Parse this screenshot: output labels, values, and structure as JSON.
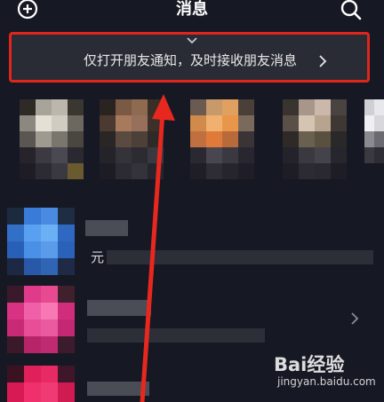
{
  "header": {
    "title": "消息",
    "add_icon": "add-circle-icon",
    "search_icon": "search-icon"
  },
  "banner": {
    "expand_icon": "chevron-down-icon",
    "text": "仅打开朋友通知，及时接收朋友消息",
    "arrow_icon": "chevron-right-icon",
    "highlight_color": "#e0251c"
  },
  "conversations": {
    "snippet_char": "元",
    "row_arrow_icon": "chevron-right-icon"
  },
  "watermark": {
    "brand": "Bai经验",
    "url": "jingyan.baidu.com"
  },
  "colors": {
    "background": "#161823",
    "banner_bg": "#2a2c35",
    "annotation_red": "#e8281e"
  }
}
